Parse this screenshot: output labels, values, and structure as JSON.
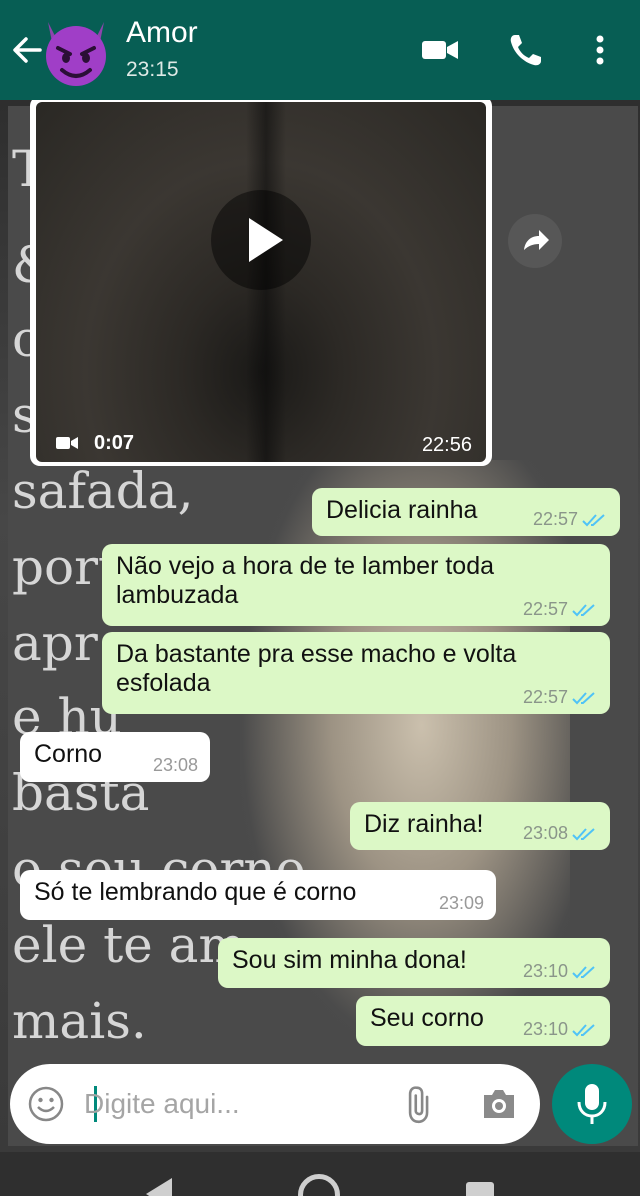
{
  "header": {
    "back_icon": "arrow-left-icon",
    "avatar_icon": "smiling-devil-emoji-icon",
    "contact_name": "Amor",
    "last_seen": "23:15",
    "actions": [
      "video-camera-icon",
      "phone-icon",
      "more-vertical-icon"
    ],
    "bg_color": "#075e54"
  },
  "background_text": [
    "T",
    "&",
    "c",
    "s",
    "safada,",
    "port",
    "apr",
    "e hu",
    "basta",
    "o seu corno",
    "ele te am",
    "mais."
  ],
  "video_message": {
    "duration": "0:07",
    "time": "22:56",
    "play_icon": "play-icon",
    "forward_icon": "share-forward-icon"
  },
  "messages": [
    {
      "direction": "out",
      "text": "Delicia rainha",
      "time": "22:57",
      "status": "read"
    },
    {
      "direction": "out",
      "text": "Não vejo a hora de te lamber toda lambuzada",
      "time": "22:57",
      "status": "read"
    },
    {
      "direction": "out",
      "text": "Da bastante pra esse macho e volta esfolada",
      "time": "22:57",
      "status": "read"
    },
    {
      "direction": "in",
      "text": "Corno",
      "time": "23:08"
    },
    {
      "direction": "out",
      "text": "Diz rainha!",
      "time": "23:08",
      "status": "read"
    },
    {
      "direction": "in",
      "text": "Só te lembrando que é corno",
      "time": "23:09"
    },
    {
      "direction": "out",
      "text": "Sou sim minha dona!",
      "time": "23:10",
      "status": "read"
    },
    {
      "direction": "out",
      "text": "Seu corno",
      "time": "23:10",
      "status": "read"
    }
  ],
  "composer": {
    "placeholder": "Digite aqui...",
    "value": "",
    "icons": [
      "emoji-icon",
      "attach-icon",
      "camera-icon",
      "mic-icon"
    ]
  },
  "colors": {
    "outgoing_bubble": "#dcf8c6",
    "incoming_bubble": "#ffffff",
    "read_ticks": "#4fc3f7",
    "accent": "#00897b"
  },
  "nav": [
    "back",
    "home",
    "recents"
  ]
}
